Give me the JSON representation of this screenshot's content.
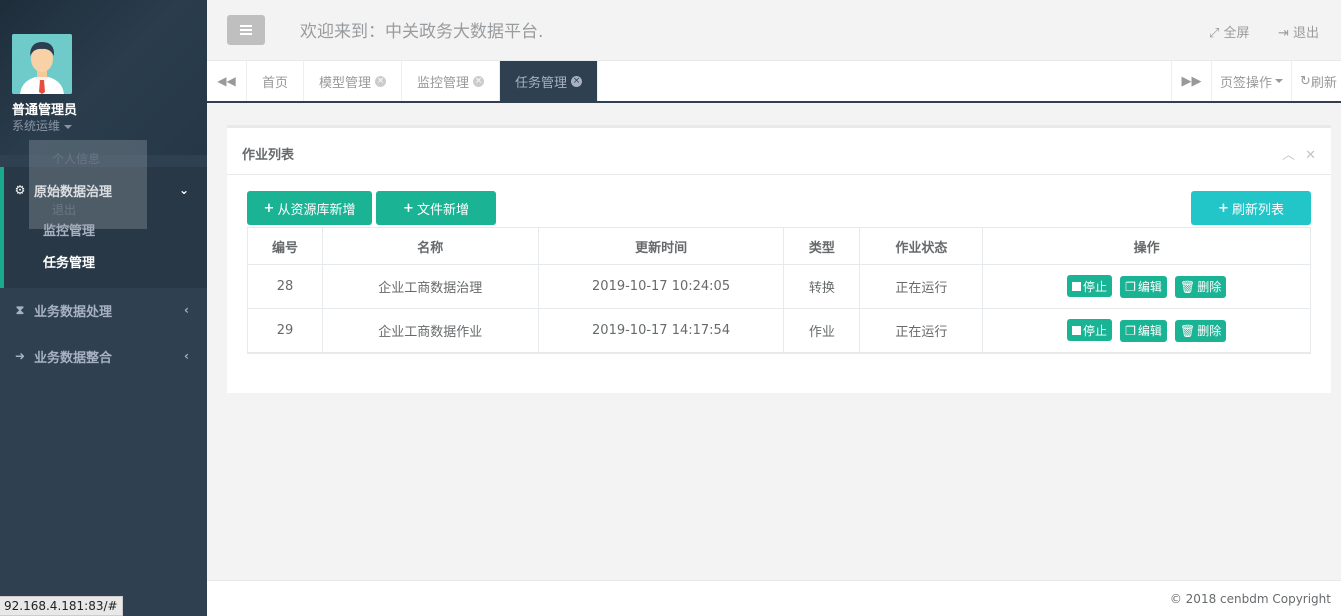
{
  "sidebar": {
    "user_name": "普通管理员",
    "user_role": "系统运维",
    "dropdown": [
      "个人信息",
      "退出"
    ],
    "menu": [
      {
        "label": "原始数据治理",
        "icon": "gears-icon",
        "arrow": "⌄"
      },
      {
        "label": "业务数据处理",
        "icon": "hourglass-icon",
        "arrow": "‹"
      },
      {
        "label": "业务数据整合",
        "icon": "sign-in-icon",
        "arrow": "‹"
      }
    ],
    "submenu": [
      "监控管理",
      "任务管理"
    ],
    "status_url": "92.168.4.181:83/#"
  },
  "header": {
    "welcome": "欢迎来到：中关政务大数据平台.",
    "fullscreen": "全屏",
    "logout": "退出"
  },
  "tabs": {
    "items": [
      "首页",
      "模型管理",
      "监控管理",
      "任务管理"
    ],
    "active": "任务管理",
    "page_ops": "页签操作",
    "refresh": "刷新"
  },
  "panel": {
    "title": "作业列表",
    "buttons": {
      "add_from_db": "从资源库新增",
      "add_file": "文件新增",
      "refresh_list": "刷新列表"
    },
    "columns": [
      "编号",
      "名称",
      "更新时间",
      "类型",
      "作业状态",
      "操作"
    ],
    "rows": [
      {
        "id": "28",
        "name": "企业工商数据治理",
        "updated": "2019-10-17 10:24:05",
        "type": "转换",
        "status": "正在运行"
      },
      {
        "id": "29",
        "name": "企业工商数据作业",
        "updated": "2019-10-17 14:17:54",
        "type": "作业",
        "status": "正在运行"
      }
    ],
    "actions": {
      "stop": "停止",
      "edit": "编辑",
      "delete": "删除"
    }
  },
  "footer": {
    "copyright": "© 2018 cenbdm Copyright"
  },
  "colors": {
    "sidebar": "#2f4050",
    "primary": "#1ab394",
    "info": "#23c6c8"
  }
}
